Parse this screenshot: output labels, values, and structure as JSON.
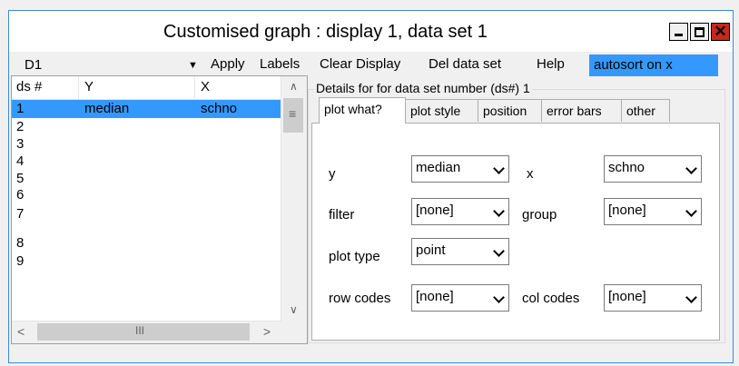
{
  "window": {
    "title": "Customised graph : display 1, data set 1",
    "close_glyph": "✕"
  },
  "menubar": {
    "display_select": "D1",
    "items": [
      "Apply",
      "Labels",
      "Clear Display",
      "Del data set",
      "Help"
    ],
    "autosort": "autosort on x"
  },
  "list": {
    "headers": [
      "ds #",
      "Y",
      "X"
    ],
    "rows": [
      {
        "ds": "1",
        "y": "median",
        "x": "schno",
        "selected": true
      },
      {
        "ds": "2",
        "y": "",
        "x": ""
      },
      {
        "ds": "3",
        "y": "",
        "x": ""
      },
      {
        "ds": "4",
        "y": "",
        "x": ""
      },
      {
        "ds": "5",
        "y": "",
        "x": ""
      },
      {
        "ds": "6",
        "y": "",
        "x": ""
      },
      {
        "ds": "7",
        "y": "",
        "x": ""
      },
      {
        "ds": "8",
        "y": "",
        "x": ""
      },
      {
        "ds": "9",
        "y": "",
        "x": ""
      }
    ]
  },
  "details": {
    "group_label": "Details for for data set number (ds#) 1",
    "tabs": [
      "plot what?",
      "plot style",
      "position",
      "error bars",
      "other"
    ],
    "active_tab": "plot what?",
    "fields": {
      "y_label": "y",
      "y_value": "median",
      "x_label": "x",
      "x_value": "schno",
      "filter_label": "filter",
      "filter_value": "[none]",
      "group_label": "group",
      "group_value": "[none]",
      "plot_type_label": "plot type",
      "plot_type_value": "point",
      "row_codes_label": "row codes",
      "row_codes_value": "[none]",
      "col_codes_label": "col codes",
      "col_codes_value": "[none]"
    }
  },
  "colors": {
    "selection": "#3399ff",
    "close_button": "#c7281c",
    "window_border": "#3b8bdc"
  },
  "icons": [
    "minimize-icon",
    "maximize-icon",
    "close-icon",
    "dropdown-arrow-icon",
    "scroll-up-icon",
    "scroll-down-icon",
    "scroll-left-icon",
    "scroll-right-icon"
  ]
}
